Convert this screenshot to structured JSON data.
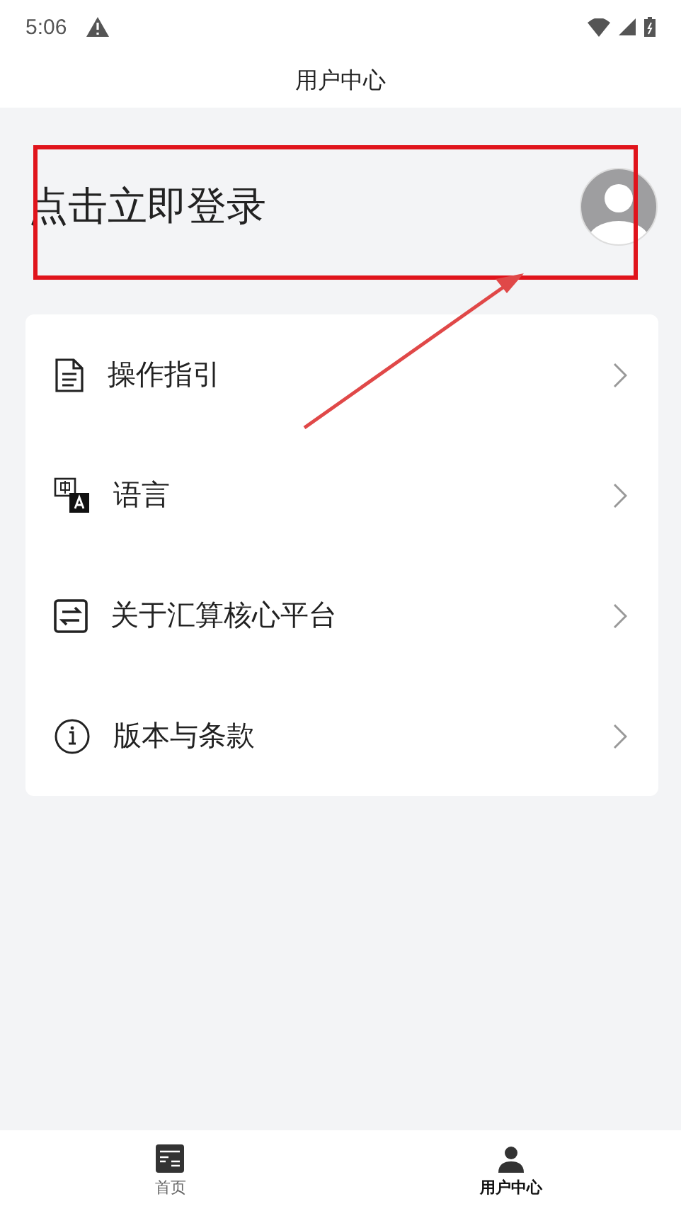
{
  "status_bar": {
    "time": "5:06"
  },
  "header": {
    "title": "用户中心"
  },
  "login": {
    "label": "点击立即登录"
  },
  "menu": [
    {
      "kind": "guide",
      "label": "操作指引"
    },
    {
      "kind": "language",
      "label": "语言"
    },
    {
      "kind": "about",
      "label": "关于汇算核心平台"
    },
    {
      "kind": "terms",
      "label": "版本与条款"
    }
  ],
  "annotation": {
    "kind": "frame-arrow"
  },
  "tabs": [
    {
      "kind": "home",
      "label": "首页",
      "selected": false
    },
    {
      "kind": "user",
      "label": "用户中心",
      "selected": true
    }
  ]
}
